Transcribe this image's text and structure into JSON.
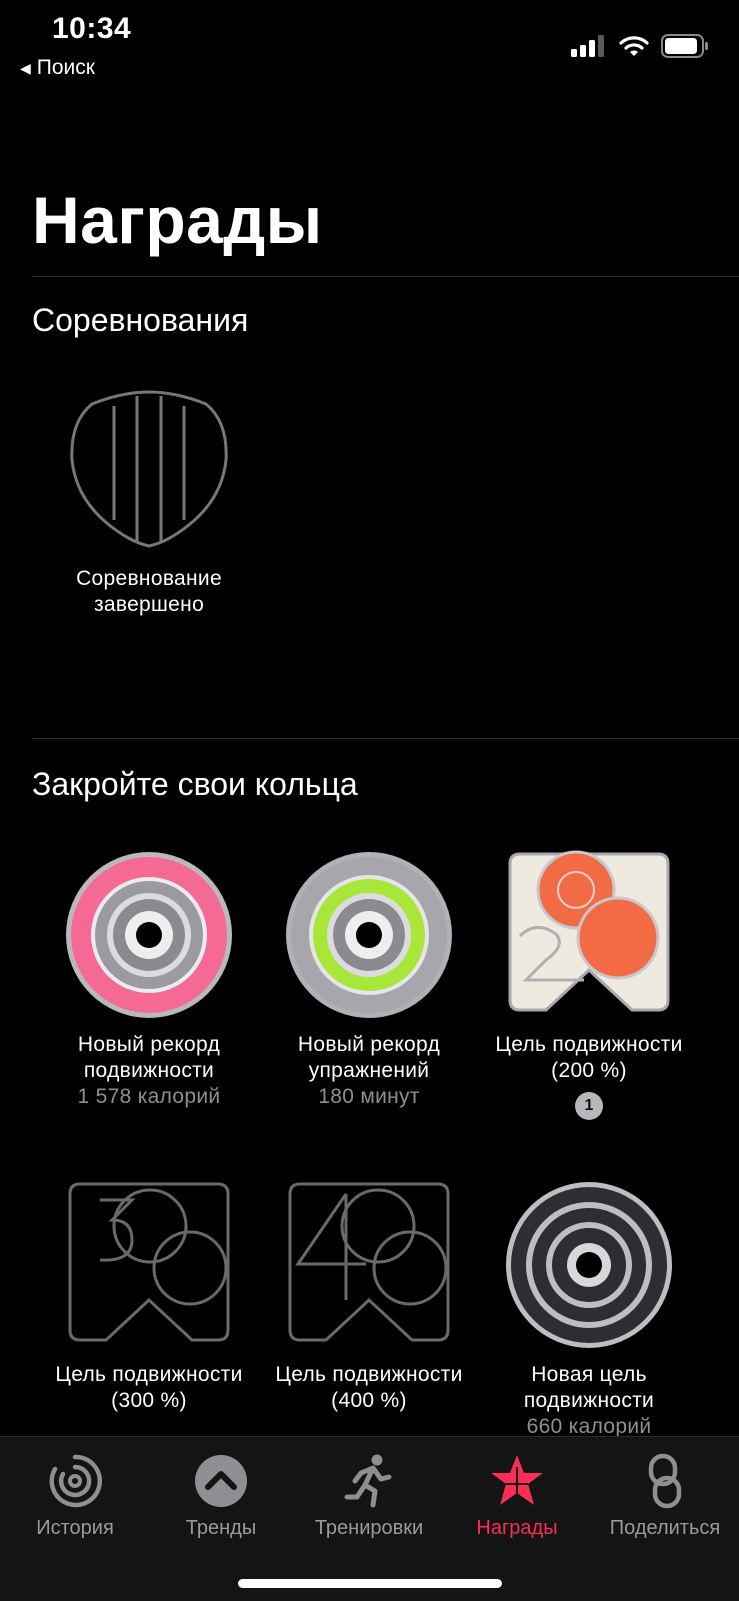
{
  "status": {
    "time": "10:34",
    "back_label": "Поиск"
  },
  "page": {
    "title": "Награды"
  },
  "sections": {
    "competitions": {
      "title": "Соревнования",
      "awards": [
        {
          "label": "Соревнование завершено"
        }
      ]
    },
    "rings": {
      "title": "Закройте свои кольца",
      "awards": [
        {
          "label": "Новый рекорд подвижности",
          "sub": "1 578 калорий",
          "color": "#f46a95"
        },
        {
          "label": "Новый рекорд упражнений",
          "sub": "180 минут",
          "color": "#a9e63a"
        },
        {
          "label": "Цель подвижности (200 %)",
          "badge": "1",
          "color": "#f26b45"
        },
        {
          "label": "Цель подвижности (300 %)"
        },
        {
          "label": "Цель подвижности (400 %)"
        },
        {
          "label": "Новая цель подвижности",
          "sub": "660 калорий"
        }
      ]
    }
  },
  "tabs": [
    {
      "label": "История",
      "icon": "history-rings-icon"
    },
    {
      "label": "Тренды",
      "icon": "trends-chevron-up-icon"
    },
    {
      "label": "Тренировки",
      "icon": "running-figure-icon"
    },
    {
      "label": "Награды",
      "icon": "awards-star-icon",
      "active": true
    },
    {
      "label": "Поделиться",
      "icon": "share-links-icon"
    }
  ],
  "colors": {
    "accent": "#fa2d55",
    "background": "#000000",
    "secondary_text": "#8e8e93"
  }
}
